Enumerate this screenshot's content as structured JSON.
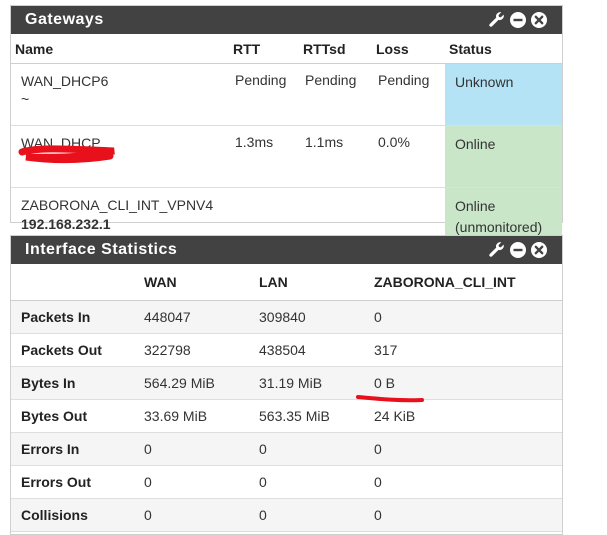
{
  "gateways": {
    "title": "Gateways",
    "columns": [
      "Name",
      "RTT",
      "RTTsd",
      "Loss",
      "Status"
    ],
    "rows": [
      {
        "name": "WAN_DHCP6",
        "sub": "~",
        "rtt": "Pending",
        "rttsd": "Pending",
        "loss": "Pending",
        "status": "Unknown",
        "status_line2": ""
      },
      {
        "name": "WAN_DHCP",
        "sub": "",
        "rtt": "1.3ms",
        "rttsd": "1.1ms",
        "loss": "0.0%",
        "status": "Online",
        "status_line2": ""
      },
      {
        "name": "ZABORONA_CLI_INT_VPNV4",
        "sub": "192.168.232.1",
        "rtt": "",
        "rttsd": "",
        "loss": "",
        "status": "Online",
        "status_line2": "(unmonitored)"
      }
    ]
  },
  "interface_statistics": {
    "title": "Interface Statistics",
    "columns": [
      "",
      "WAN",
      "LAN",
      "ZABORONA_CLI_INT"
    ],
    "rows": [
      {
        "label": "Packets In",
        "values": [
          "448047",
          "309840",
          "0"
        ]
      },
      {
        "label": "Packets Out",
        "values": [
          "322798",
          "438504",
          "317"
        ]
      },
      {
        "label": "Bytes In",
        "values": [
          "564.29 MiB",
          "31.19 MiB",
          "0 B"
        ]
      },
      {
        "label": "Bytes Out",
        "values": [
          "33.69 MiB",
          "563.35 MiB",
          "24 KiB"
        ]
      },
      {
        "label": "Errors In",
        "values": [
          "0",
          "0",
          "0"
        ]
      },
      {
        "label": "Errors Out",
        "values": [
          "0",
          "0",
          "0"
        ]
      },
      {
        "label": "Collisions",
        "values": [
          "0",
          "0",
          "0"
        ]
      }
    ]
  },
  "icons": [
    "wrench-icon",
    "minus-circle-icon",
    "close-circle-icon"
  ],
  "colors": {
    "header_bg": "#424242",
    "status_unknown_bg": "#b3e3f5",
    "status_online_bg": "#c9e6c9",
    "redaction": "#e8101a"
  }
}
